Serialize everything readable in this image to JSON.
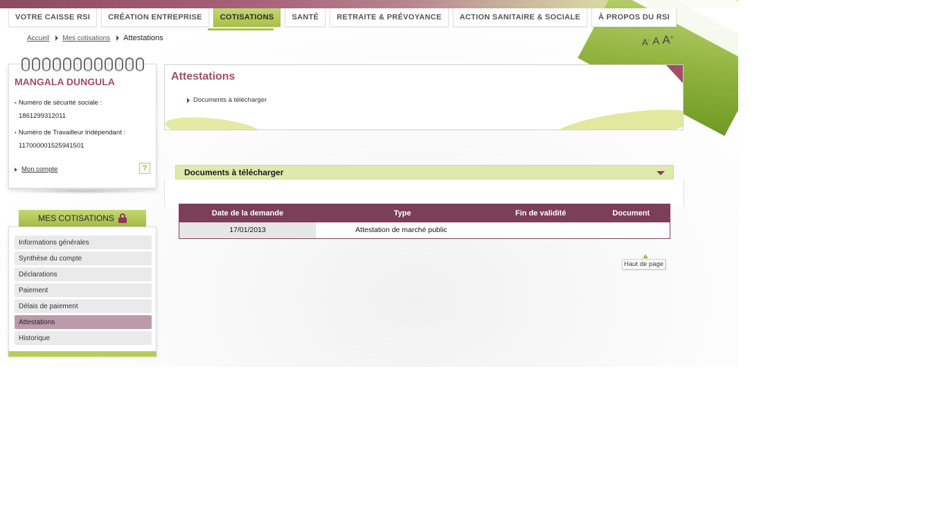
{
  "nav": {
    "tabs": [
      {
        "label": "VOTRE CAISSE RSI"
      },
      {
        "label": "CRÉATION ENTREPRISE"
      },
      {
        "label": "COTISATIONS"
      },
      {
        "label": "SANTÉ"
      },
      {
        "label": "RETRAITE & PRÉVOYANCE"
      },
      {
        "label": "ACTION SANITAIRE & SOCIALE"
      },
      {
        "label": "À PROPOS DU RSI"
      }
    ],
    "active_tab": "COTISATIONS"
  },
  "breadcrumb": {
    "home": "Accueil",
    "parent": "Mes cotisations",
    "current": "Attestations"
  },
  "font_controls": {
    "smaller": "A",
    "smaller_sup": "-",
    "normal": "A",
    "larger": "A",
    "larger_sup": "+"
  },
  "user": {
    "name": "MANGALA DUNGULA",
    "ssn_label": "Numéro de sécurité sociale :",
    "ssn_value": "1861299312011",
    "worker_label": "Numéro de Travailleur Indépendant :",
    "worker_value": "117000001525941501",
    "account_link": "Mon compte",
    "help_icon_glyph": "?"
  },
  "menu": {
    "title": "MES COTISATIONS",
    "items": [
      {
        "label": "Informations générales"
      },
      {
        "label": "Synthèse du compte"
      },
      {
        "label": "Déclarations"
      },
      {
        "label": "Paiement"
      },
      {
        "label": "Délais de paiement"
      },
      {
        "label": "Attestations"
      },
      {
        "label": "Historique"
      }
    ],
    "active_item": "Attestations"
  },
  "attestations": {
    "title": "Attestations",
    "link": "Documents à télécharger"
  },
  "documents": {
    "section_title": "Documents à télécharger",
    "table": {
      "headers": [
        "Date de la demande",
        "Type",
        "Fin de validité",
        "Document"
      ],
      "rows": [
        {
          "date": "17/01/2013",
          "type": "Attestation de marché public",
          "validity": "",
          "document": ""
        }
      ]
    },
    "back_to_top": "Haut de page"
  },
  "colors": {
    "brand_plum": "#7b3f59",
    "title_rose": "#a14f68",
    "accent_green": "#a8c04a",
    "section_green": "#e1e8ad"
  }
}
